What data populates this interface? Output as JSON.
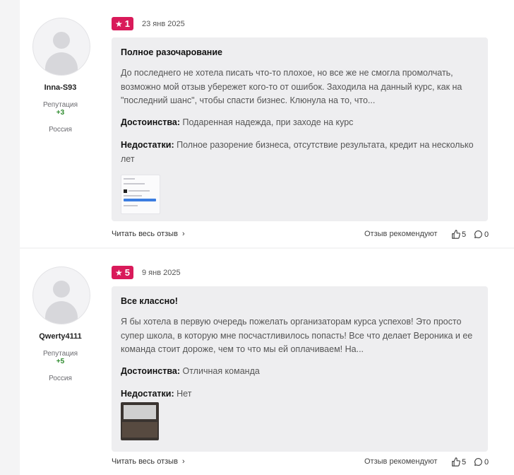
{
  "reviews": [
    {
      "author": {
        "username": "Inna-S93",
        "reputation_label": "Репутация",
        "reputation_value": "+3",
        "country": "Россия"
      },
      "rating": "1",
      "date": "23 янв 2025",
      "title": "Полное разочарование",
      "text": "До последнего не хотела писать что-то плохое, но все же не смогла промолчать, возможно мой отзыв убережет кого-то от ошибок. Заходила на данный курс, как на \"последний шанс\", чтобы спасти бизнес. Клюнула на то, что...",
      "pros_label": "Достоинства:",
      "pros": "Подаренная надежда, при заходе на курс",
      "cons_label": "Недостатки:",
      "cons": "Полное разорение бизнеса, отсутствие результата, кредит на несколько лет",
      "read_more": "Читать весь отзыв",
      "recommend": "Отзыв рекомендуют",
      "likes": "5",
      "comments": "0"
    },
    {
      "author": {
        "username": "Qwerty4111",
        "reputation_label": "Репутация",
        "reputation_value": "+5",
        "country": "Россия"
      },
      "rating": "5",
      "date": "9 янв 2025",
      "title": "Все классно!",
      "text": "Я бы хотела в первую очередь пожелать организаторам курса успехов! Это просто супер школа, в которую мне посчастливилось попасть! Все что делает Вероника и ее команда стоит дороже, чем то что мы ей оплачиваем! На...",
      "pros_label": "Достоинства:",
      "pros": "Отличная команда",
      "cons_label": "Недостатки:",
      "cons": "Нет",
      "read_more": "Читать весь отзыв",
      "recommend": "Отзыв рекомендуют",
      "likes": "5",
      "comments": "0"
    }
  ],
  "colors": {
    "badge": "#d91a5a",
    "reputation": "#2e8b2e",
    "card_bg": "#eeeef0"
  },
  "icons": [
    "user-avatar-icon",
    "star-icon",
    "chevron-right-icon",
    "thumbs-up-icon",
    "comment-icon"
  ]
}
